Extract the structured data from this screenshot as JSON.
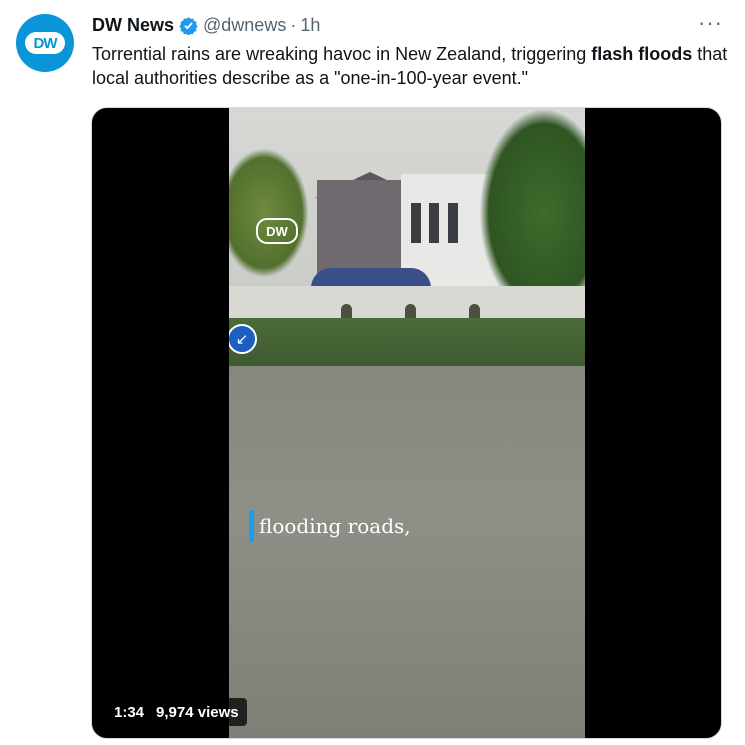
{
  "tweet": {
    "author_name": "DW News",
    "handle": "@dwnews",
    "separator": "·",
    "time": "1h",
    "avatar_text": "DW",
    "more_label": "···",
    "text_part1": "Torrential rains are wreaking havoc in New Zealand, triggering ",
    "text_bold": "flash floods",
    "text_part2": " that local authorities describe as a \"one-in-100-year event.\""
  },
  "video": {
    "watermark": "DW",
    "caption": "flooding roads,",
    "duration": "1:34",
    "views": "9,974 views"
  },
  "colors": {
    "brand_blue": "#0a95d9",
    "verified_blue": "#1d9bf0",
    "caption_bar": "#13a0f0"
  },
  "icons": [
    "verified-badge-icon",
    "more-options-icon",
    "road-sign-icon"
  ]
}
